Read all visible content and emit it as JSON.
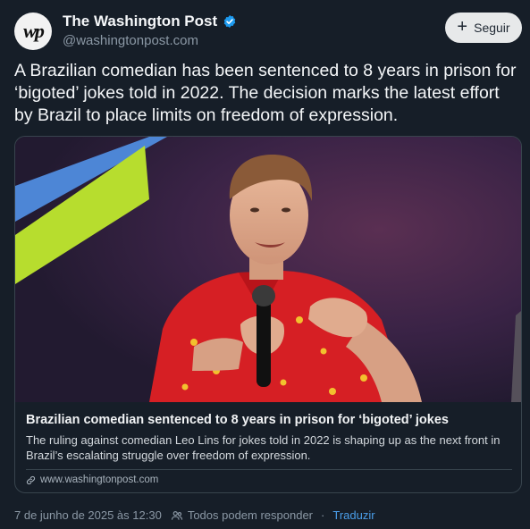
{
  "author": {
    "name": "The Washington Post",
    "handle": "@washingtonpost.com",
    "avatar_text": "wp",
    "verified_color": "#1d9bf0"
  },
  "follow": {
    "label": "Seguir",
    "icon": "plus-icon"
  },
  "post": {
    "text": "A Brazilian comedian has been sentenced to 8 years in prison for ‘bigoted’ jokes told in 2022. The decision marks the latest effort by Brazil to place limits on freedom of expression."
  },
  "card": {
    "title": "Brazilian comedian sentenced to 8 years in prison for ‘bigoted’ jokes",
    "description": "The ruling against comedian Leo Lins for jokes told in 2022 is shaping up as the next front in Brazil’s escalating struggle over freedom of expression.",
    "domain": "www.washingtonpost.com",
    "image_subject": "comedian in red patterned shirt holding microphone on stage"
  },
  "meta": {
    "timestamp": "7 de junho de 2025 às 12:30",
    "reply_setting": "Todos podem responder",
    "separator": "·",
    "translate": "Traduzir"
  }
}
